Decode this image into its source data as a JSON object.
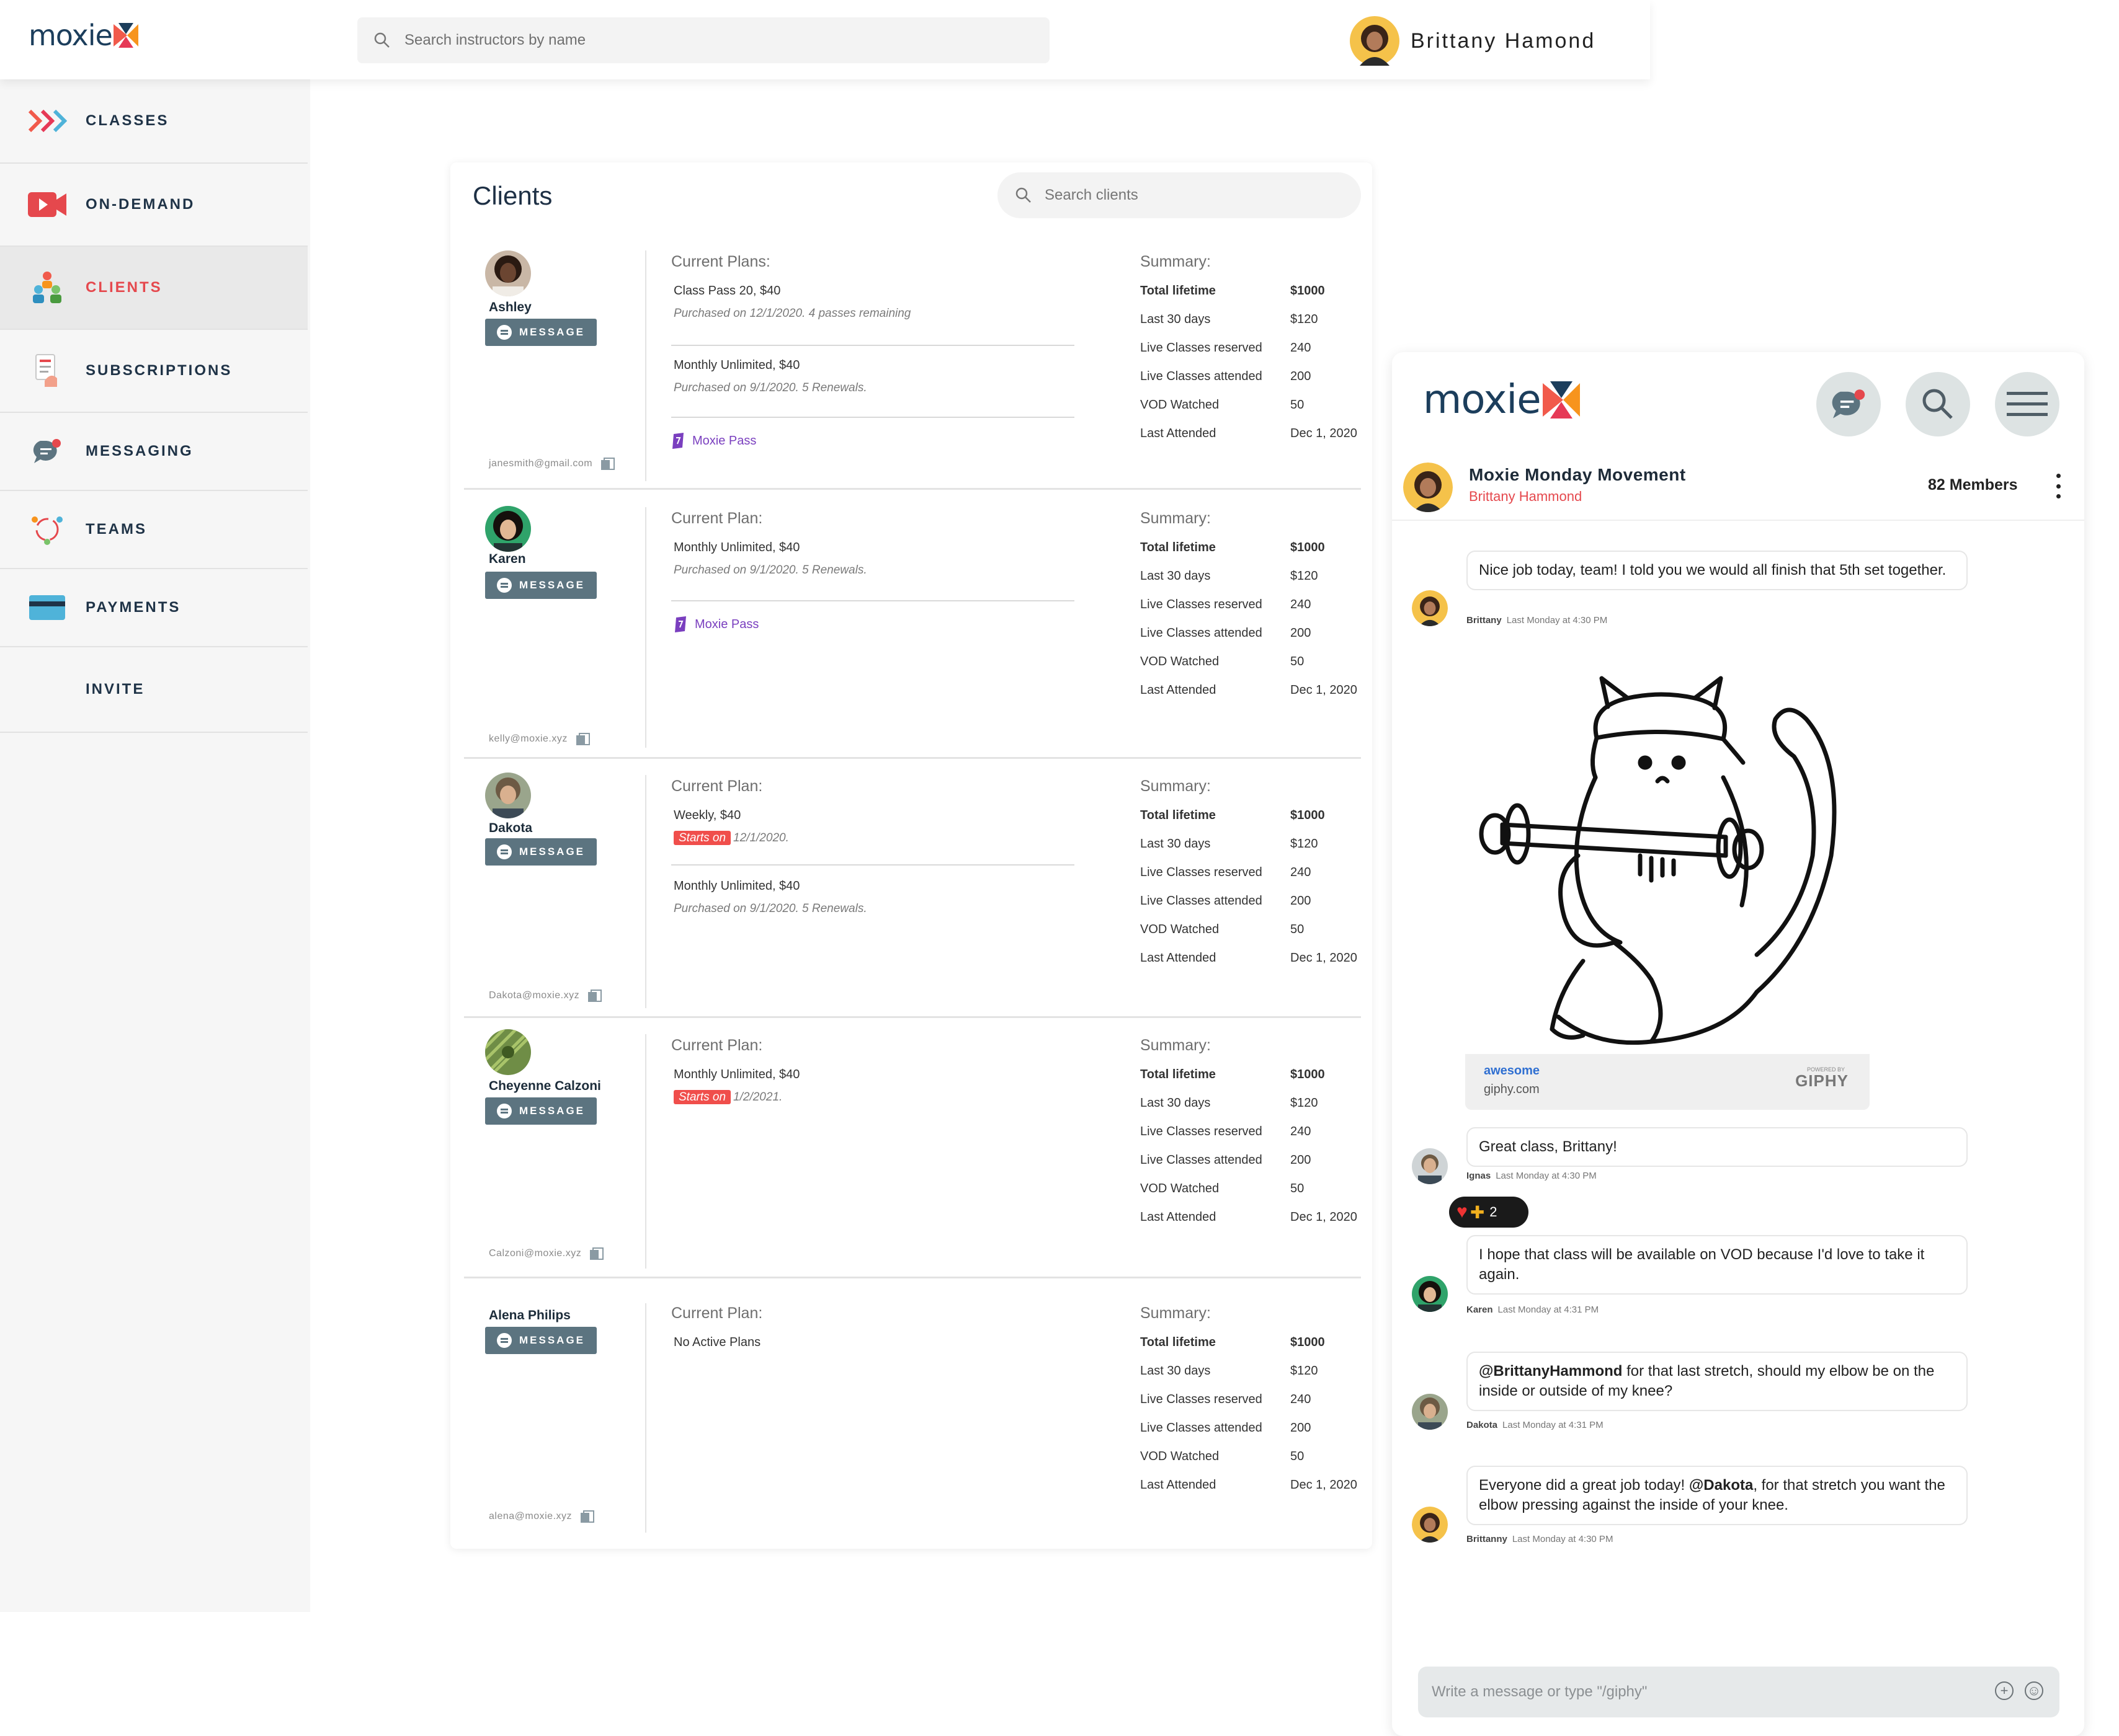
{
  "app": {
    "brand": "moxie",
    "search_placeholder": "Search instructors by name",
    "user_name": "Brittany Hamond"
  },
  "sidebar": {
    "items": [
      {
        "label": "CLASSES",
        "icon": "classes-icon"
      },
      {
        "label": "ON-DEMAND",
        "icon": "video-icon"
      },
      {
        "label": "CLIENTS",
        "icon": "clients-icon",
        "active": true
      },
      {
        "label": "SUBSCRIPTIONS",
        "icon": "subscriptions-icon"
      },
      {
        "label": "MESSAGING",
        "icon": "messaging-icon"
      },
      {
        "label": "TEAMS",
        "icon": "teams-icon"
      },
      {
        "label": "PAYMENTS",
        "icon": "credit-card-icon"
      },
      {
        "label": "INVITE",
        "icon": ""
      }
    ]
  },
  "clients": {
    "title": "Clients",
    "search_placeholder": "Search clients",
    "message_label": "MESSAGE",
    "summary_label": "Summary:",
    "list": [
      {
        "name": "Ashley",
        "email": "janesmith@gmail.com",
        "plans_label": "Current Plans:",
        "plans": [
          {
            "title": "Class Pass 20, $40",
            "sub": "Purchased on 12/1/2020. 4 passes remaining"
          },
          {
            "title": "Monthly Unlimited, $40",
            "sub": "Purchased on 9/1/2020. 5 Renewals."
          }
        ],
        "pass": "Moxie Pass",
        "summary": [
          {
            "k": "Total lifetime",
            "v": "$1000"
          },
          {
            "k": "Last 30 days",
            "v": "$120"
          },
          {
            "k": "Live Classes reserved",
            "v": "240"
          },
          {
            "k": "Live Classes attended",
            "v": "200"
          },
          {
            "k": "VOD Watched",
            "v": "50"
          },
          {
            "k": "Last Attended",
            "v": "Dec 1, 2020"
          }
        ]
      },
      {
        "name": "Karen",
        "email": "kelly@moxie.xyz",
        "plans_label": "Current Plan:",
        "plans": [
          {
            "title": "Monthly Unlimited, $40",
            "sub": "Purchased on 9/1/2020. 5 Renewals."
          }
        ],
        "pass": "Moxie Pass",
        "summary": [
          {
            "k": "Total lifetime",
            "v": "$1000"
          },
          {
            "k": "Last 30 days",
            "v": "$120"
          },
          {
            "k": "Live Classes reserved",
            "v": "240"
          },
          {
            "k": "Live Classes attended",
            "v": "200"
          },
          {
            "k": "VOD Watched",
            "v": "50"
          },
          {
            "k": "Last Attended",
            "v": "Dec 1, 2020"
          }
        ]
      },
      {
        "name": "Dakota",
        "email": "Dakota@moxie.xyz",
        "plans_label": "Current Plan:",
        "plans": [
          {
            "title": "Weekly, $40",
            "tag": "Starts on",
            "sub": "12/1/2020."
          },
          {
            "title": "Monthly Unlimited, $40",
            "sub": "Purchased on 9/1/2020. 5 Renewals."
          }
        ],
        "summary": [
          {
            "k": "Total lifetime",
            "v": "$1000"
          },
          {
            "k": "Last 30 days",
            "v": "$120"
          },
          {
            "k": "Live Classes reserved",
            "v": "240"
          },
          {
            "k": "Live Classes attended",
            "v": "200"
          },
          {
            "k": "VOD Watched",
            "v": "50"
          },
          {
            "k": "Last Attended",
            "v": "Dec 1, 2020"
          }
        ]
      },
      {
        "name": "Cheyenne Calzoni",
        "email": "Calzoni@moxie.xyz",
        "plans_label": "Current Plan:",
        "plans": [
          {
            "title": "Monthly Unlimited, $40",
            "tag": "Starts on",
            "sub": "1/2/2021."
          }
        ],
        "summary": [
          {
            "k": "Total lifetime",
            "v": "$1000"
          },
          {
            "k": "Last 30 days",
            "v": "$120"
          },
          {
            "k": "Live Classes reserved",
            "v": "240"
          },
          {
            "k": "Live Classes attended",
            "v": "200"
          },
          {
            "k": "VOD Watched",
            "v": "50"
          },
          {
            "k": "Last Attended",
            "v": "Dec 1, 2020"
          }
        ]
      },
      {
        "name": "Alena Philips",
        "email": "alena@moxie.xyz",
        "plans_label": "Current Plan:",
        "plans": [
          {
            "title": "No Active Plans"
          }
        ],
        "summary": [
          {
            "k": "Total lifetime",
            "v": "$1000"
          },
          {
            "k": "Last 30 days",
            "v": "$120"
          },
          {
            "k": "Live Classes reserved",
            "v": "240"
          },
          {
            "k": "Live Classes attended",
            "v": "200"
          },
          {
            "k": "VOD Watched",
            "v": "50"
          },
          {
            "k": "Last Attended",
            "v": "Dec 1, 2020"
          }
        ]
      }
    ]
  },
  "chat": {
    "group_name": "Moxie Monday Movement",
    "host": "Brittany Hammond",
    "members": "82 Members",
    "messages": [
      {
        "text": "Nice job today, team! I told you we would all finish that 5th set together.",
        "author": "Brittany",
        "time": "Last Monday at 4:30 PM"
      },
      {
        "text": "Great class, Brittany!",
        "author": "Ignas",
        "time": "Last Monday at 4:30 PM"
      },
      {
        "text": "I hope that class will be available on VOD because I'd love to take it again.",
        "author": "Karen",
        "time": "Last Monday at 4:31 PM"
      },
      {
        "mention": "@BrittanyHammond",
        "text": " for that last stretch, should my elbow be on the inside or outside of my knee?",
        "author": "Dakota",
        "time": "Last Monday at 4:31 PM"
      },
      {
        "pre": "Everyone did a great job today! ",
        "mention": "@Dakota",
        "text": ", for that stretch you want the elbow pressing against the inside of your knee.",
        "author": "Brittanny",
        "time": "Last Monday at 4:30 PM"
      }
    ],
    "giphy": {
      "tag": "awesome",
      "source": "giphy.com",
      "brand": "GIPHY",
      "powered": "POWERED BY"
    },
    "reaction_count": "2",
    "compose_placeholder": "Write a message or type \"/giphy\""
  },
  "colors": {
    "accent_red": "#e5484d",
    "navy": "#1c3e5c",
    "message_button": "#5c7480",
    "pass_purple": "#7a3fbf"
  }
}
